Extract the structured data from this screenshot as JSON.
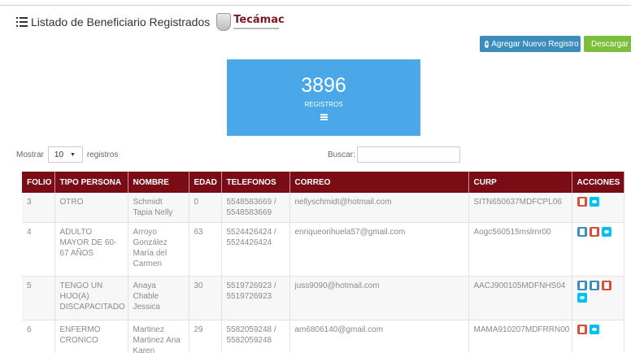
{
  "header": {
    "title": "Listado de Beneficiario Registrados",
    "logo_name": "Tecámac"
  },
  "toolbar": {
    "add_label": "Agregar Nuevo Registro",
    "download_label": "Descargar"
  },
  "stat": {
    "count": "3896",
    "label": "REGISTROS"
  },
  "controls": {
    "show_label": "Mostrar",
    "page_size": "10",
    "records_label": "registros",
    "search_label": "Buscar:",
    "search_value": ""
  },
  "table": {
    "headers": [
      "FOLIO",
      "TIPO PERSONA",
      "NOMBRE",
      "EDAD",
      "TELEFONOS",
      "CORREO",
      "CURP",
      "ACCIONES"
    ],
    "rows": [
      {
        "folio": "3",
        "tipo": "OTRO",
        "nombre": "Schmidt Tapia Nelly",
        "edad": "0",
        "telefonos": "5548583669 / 5548583669",
        "correo": "nellyschmidt@hotmail.com",
        "curp": "SITN650637MDFCPL06"
      },
      {
        "folio": "4",
        "tipo": "ADULTO MAYOR DE 60-67 AÑOS",
        "nombre": "Arroyo González María del Carmen",
        "edad": "63",
        "telefonos": "5524426424 / 5524426424",
        "correo": "enriqueorihuela57@gmail.com",
        "curp": "Aogc560515mslrnr00"
      },
      {
        "folio": "5",
        "tipo": "TENGO UN HIJO(A) DISCAPACITADO",
        "nombre": "Anaya Chable Jessica",
        "edad": "30",
        "telefonos": "5519726923 / 5519726923",
        "correo": "juss9090@hotmail.com",
        "curp": "AACJ900105MDFNHS04"
      },
      {
        "folio": "6",
        "tipo": "ENFERMO CRONICO",
        "nombre": "Martinez Martinez Ana Karen",
        "edad": "29",
        "telefonos": "5582059248 / 5582059248",
        "correo": "am6806140@gmail.com",
        "curp": "MAMA910207MDFRRN00"
      }
    ]
  },
  "colors": {
    "header_bg": "#7a0c16",
    "stat_bg": "#4aa8e8",
    "btn_primary": "#3c8dbc",
    "btn_success": "#7bbf3a",
    "btn_danger": "#dd4b39",
    "btn_info": "#00c0ef"
  }
}
